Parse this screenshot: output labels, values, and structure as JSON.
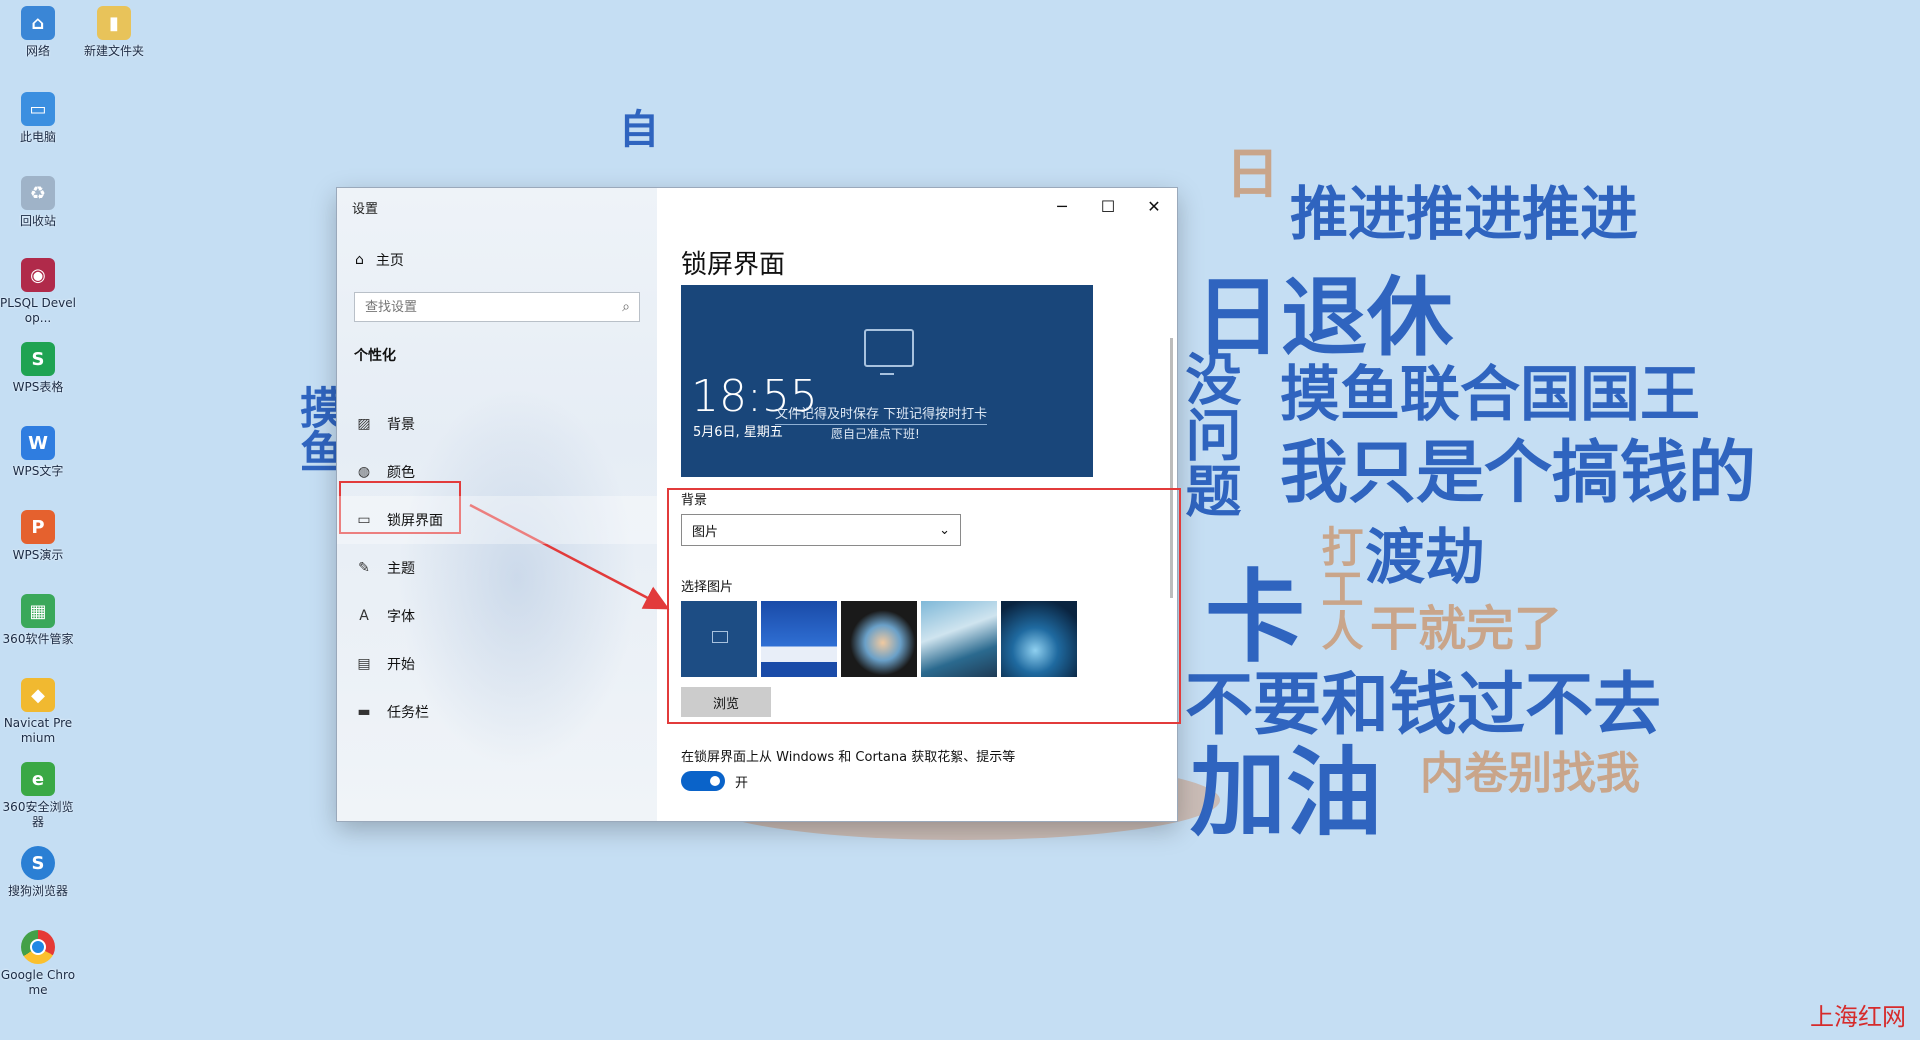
{
  "desktop": {
    "icons": [
      {
        "label": "网络",
        "icon": "network-icon"
      },
      {
        "label": "新建文件夹",
        "icon": "folder-icon"
      },
      {
        "label": "此电脑",
        "icon": "computer-icon"
      },
      {
        "label": "回收站",
        "icon": "recycle-bin-icon"
      },
      {
        "label": "PLSQL Develop...",
        "icon": "plsql-icon"
      },
      {
        "label": "WPS表格",
        "icon": "wps-sheet-icon"
      },
      {
        "label": "WPS文字",
        "icon": "wps-writer-icon"
      },
      {
        "label": "WPS演示",
        "icon": "wps-presentation-icon"
      },
      {
        "label": "360软件管家",
        "icon": "360-manager-icon"
      },
      {
        "label": "Navicat Premium",
        "icon": "navicat-icon"
      },
      {
        "label": "360安全浏览器",
        "icon": "360-browser-icon"
      },
      {
        "label": "搜狗浏览器",
        "icon": "sogou-browser-icon"
      },
      {
        "label": "Google Chrome",
        "icon": "chrome-icon"
      }
    ]
  },
  "wallpaper": {
    "words": [
      "推进推进推进",
      "日退休",
      "摸鱼联合国国王",
      "我只是个搞钱的",
      "渡劫",
      "卡",
      "干就完了",
      "不要和钱过不去",
      "加油",
      "内卷别找我"
    ]
  },
  "window": {
    "title": "设置",
    "controls": {
      "minimize": "─",
      "maximize": "☐",
      "close": "✕"
    },
    "sidebar": {
      "home": "主页",
      "search_placeholder": "查找设置",
      "section": "个性化",
      "items": [
        {
          "label": "背景",
          "icon": "image-icon"
        },
        {
          "label": "颜色",
          "icon": "palette-icon"
        },
        {
          "label": "锁屏界面",
          "icon": "lock-screen-icon"
        },
        {
          "label": "主题",
          "icon": "theme-icon"
        },
        {
          "label": "字体",
          "icon": "font-icon"
        },
        {
          "label": "开始",
          "icon": "start-icon"
        },
        {
          "label": "任务栏",
          "icon": "taskbar-icon"
        }
      ],
      "active": "锁屏界面"
    },
    "content": {
      "title": "锁屏界面",
      "preview": {
        "time": "18:55",
        "date": "5月6日, 星期五",
        "message_line1": "文件记得及时保存 下班记得按时打卡",
        "message_line2": "愿自己准点下班!"
      },
      "background_label": "背景",
      "background_value": "图片",
      "choose_picture_label": "选择图片",
      "browse_button": "浏览",
      "cortana_label": "在锁屏界面上从 Windows 和 Cortana 获取花絮、提示等",
      "toggle_state": "开"
    }
  },
  "watermark": "上海红网",
  "colors": {
    "accent": "#0a63c9",
    "annotation": "#e23b3b",
    "preview_bg": "#19467a"
  }
}
